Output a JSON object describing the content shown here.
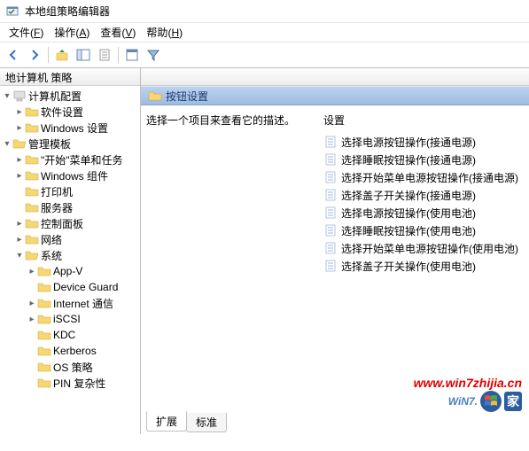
{
  "title": "本地组策略编辑器",
  "menus": {
    "file": {
      "label": "文件",
      "hotkey": "F"
    },
    "action": {
      "label": "操作",
      "hotkey": "A"
    },
    "view": {
      "label": "查看",
      "hotkey": "V"
    },
    "help": {
      "label": "帮助",
      "hotkey": "H"
    }
  },
  "tree_header": "地计算机 策略",
  "tree": {
    "root": "计算机配置",
    "lvl2": {
      "software": "软件设置",
      "windows": "Windows 设置"
    },
    "admin": "管理模板",
    "lvl3": {
      "startmenu": "\"开始\"菜单和任务",
      "wincomp": "Windows 组件",
      "printer": "打印机",
      "server": "服务器",
      "ctrlpanel": "控制面板",
      "network": "网络",
      "system": "系统"
    },
    "lvl4": {
      "appv": "App-V",
      "devguard": "Device Guard",
      "inet": "Internet 通信",
      "iscsi": "iSCSI",
      "kdc": "KDC",
      "kerberos": "Kerberos",
      "os": "OS 策略",
      "pin": "PIN 复杂性"
    }
  },
  "right": {
    "title": "按钮设置",
    "desc": "选择一个项目来查看它的描述。",
    "col": "设置",
    "items": [
      "选择电源按钮操作(接通电源)",
      "选择睡眠按钮操作(接通电源)",
      "选择开始菜单电源按钮操作(接通电源)",
      "选择盖子开关操作(接通电源)",
      "选择电源按钮操作(使用电池)",
      "选择睡眠按钮操作(使用电池)",
      "选择开始菜单电源按钮操作(使用电池)",
      "选择盖子开关操作(使用电池)"
    ]
  },
  "tabs": {
    "ext": "扩展",
    "std": "标准"
  },
  "watermark_url": "www.win7zhijia.cn",
  "watermark_logo_text": "WiN7.",
  "watermark_cn": "家"
}
